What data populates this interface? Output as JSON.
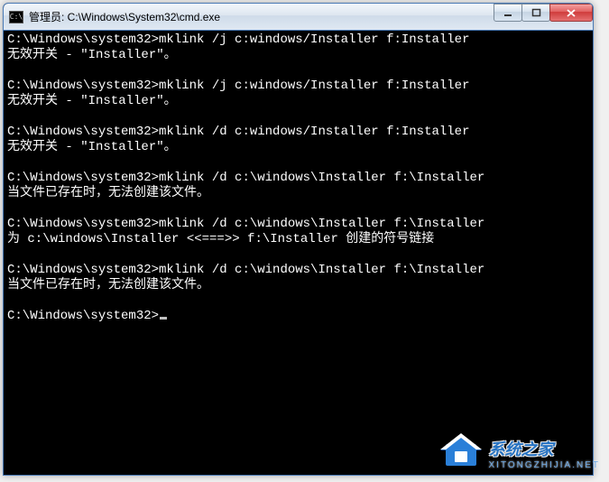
{
  "window": {
    "title": "管理员: C:\\Windows\\System32\\cmd.exe",
    "icon_label": "C:\\"
  },
  "controls": {
    "minimize": "minimize",
    "maximize": "maximize",
    "close": "close"
  },
  "console": {
    "prompt": "C:\\Windows\\system32>",
    "lines": [
      {
        "type": "cmd",
        "prompt": "C:\\Windows\\system32>",
        "text": "mklink /j c:windows/Installer f:Installer"
      },
      {
        "type": "out",
        "text": "无效开关 - \"Installer\"。"
      },
      {
        "type": "blank"
      },
      {
        "type": "cmd",
        "prompt": "C:\\Windows\\system32>",
        "text": "mklink /j c:windows/Installer f:Installer"
      },
      {
        "type": "out",
        "text": "无效开关 - \"Installer\"。"
      },
      {
        "type": "blank"
      },
      {
        "type": "cmd",
        "prompt": "C:\\Windows\\system32>",
        "text": "mklink /d c:windows/Installer f:Installer"
      },
      {
        "type": "out",
        "text": "无效开关 - \"Installer\"。"
      },
      {
        "type": "blank"
      },
      {
        "type": "cmd",
        "prompt": "C:\\Windows\\system32>",
        "text": "mklink /d c:\\windows\\Installer f:\\Installer"
      },
      {
        "type": "out",
        "text": "当文件已存在时，无法创建该文件。"
      },
      {
        "type": "blank"
      },
      {
        "type": "cmd",
        "prompt": "C:\\Windows\\system32>",
        "text": "mklink /d c:\\windows\\Installer f:\\Installer"
      },
      {
        "type": "out",
        "text": "为 c:\\windows\\Installer <<===>> f:\\Installer 创建的符号链接"
      },
      {
        "type": "blank"
      },
      {
        "type": "cmd",
        "prompt": "C:\\Windows\\system32>",
        "text": "mklink /d c:\\windows\\Installer f:\\Installer"
      },
      {
        "type": "out",
        "text": "当文件已存在时，无法创建该文件。"
      },
      {
        "type": "blank"
      },
      {
        "type": "prompt-only",
        "prompt": "C:\\Windows\\system32>"
      }
    ]
  },
  "watermark": {
    "text": "系统之家",
    "url": "XITONGZHIJIA.NET"
  }
}
